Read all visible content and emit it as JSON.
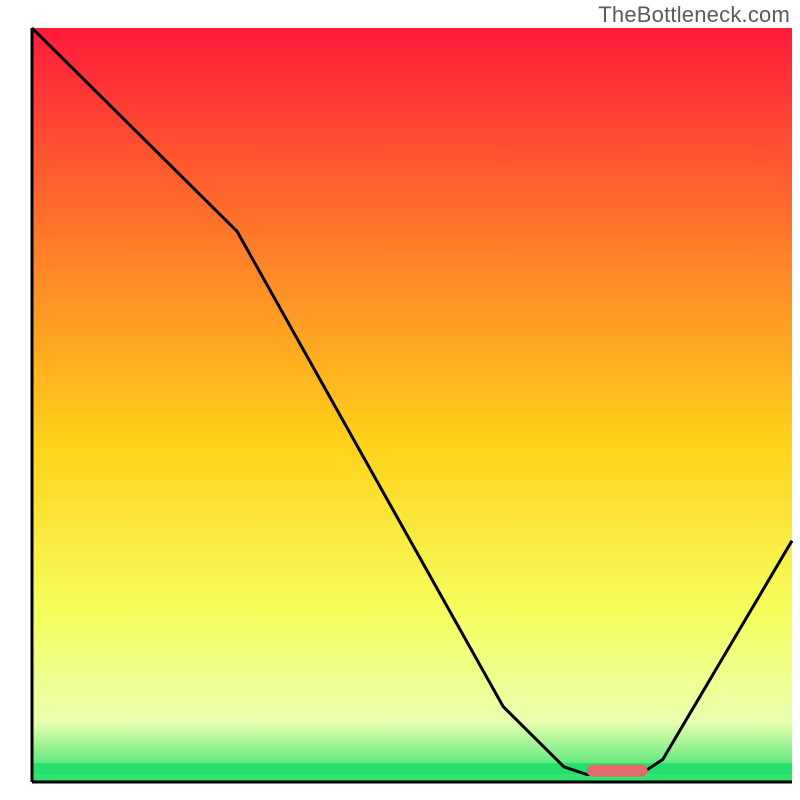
{
  "watermark": "TheBottleneck.com",
  "colors": {
    "curve": "#000000",
    "axis": "#000000",
    "marker_fill": "#e46a6a",
    "gradient": {
      "top": "#ff1a3a",
      "upper": "#ff7a2a",
      "mid": "#ffd21a",
      "lower": "#f6ff60",
      "pale": "#eaffb0",
      "green": "#25e06a"
    }
  },
  "chart_data": {
    "type": "line",
    "title": "",
    "xlabel": "",
    "ylabel": "",
    "xlim": [
      0,
      100
    ],
    "ylim": [
      0,
      100
    ],
    "curve": [
      {
        "x": 0,
        "y": 100
      },
      {
        "x": 20,
        "y": 80
      },
      {
        "x": 27,
        "y": 73
      },
      {
        "x": 62,
        "y": 10
      },
      {
        "x": 70,
        "y": 2
      },
      {
        "x": 73,
        "y": 1
      },
      {
        "x": 80,
        "y": 1
      },
      {
        "x": 83,
        "y": 3
      },
      {
        "x": 100,
        "y": 32
      }
    ],
    "marker": {
      "x_start": 73,
      "x_end": 81,
      "y": 1.5
    },
    "green_band_top_y": 2.5,
    "green_band_bottom_y": 1.0
  }
}
